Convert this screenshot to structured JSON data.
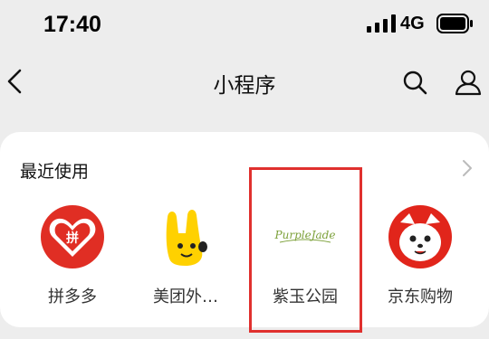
{
  "status_bar": {
    "time": "17:40",
    "network": "4G"
  },
  "navbar": {
    "title": "小程序"
  },
  "recent": {
    "heading": "最近使用",
    "apps": [
      {
        "label": "拼多多",
        "icon": "pinduoduo-icon"
      },
      {
        "label": "美团外…",
        "icon": "meituan-waimai-icon"
      },
      {
        "label": "紫玉公园",
        "icon": "purple-jade-icon",
        "logo_text": "PurpleJade"
      },
      {
        "label": "京东购物",
        "icon": "jd-shopping-icon"
      }
    ]
  },
  "colors": {
    "highlight": "#e0302e",
    "pdd_red": "#e02e24",
    "meituan_yellow": "#ffd100",
    "jd_red": "#e1251b",
    "jade_green": "#7da13b"
  }
}
